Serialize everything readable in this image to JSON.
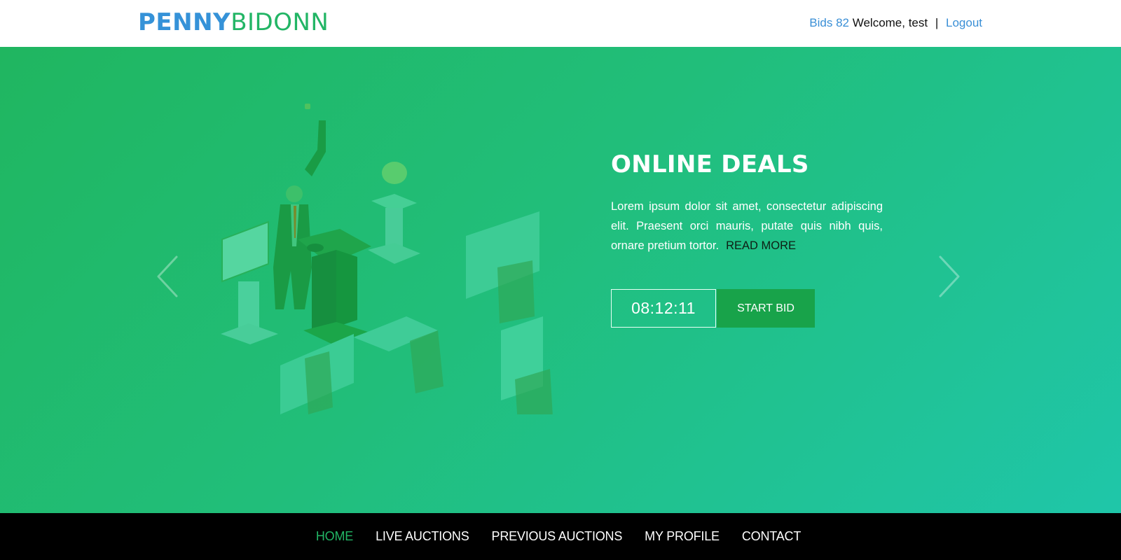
{
  "header": {
    "logo_part1": "PENNY",
    "logo_part2": "BIDONN",
    "bids_label": "Bids 82",
    "welcome_text": "Welcome, test",
    "separator": "|",
    "logout_label": "Logout"
  },
  "hero": {
    "title": "ONLINE DEALS",
    "description": "Lorem ipsum dolor sit amet, consectetur adipiscing elit. Praesent orci mauris, putate quis nibh quis, ornare pretium tortor.",
    "read_more_label": "READ MORE",
    "timer_value": "08:12:11",
    "start_bid_label": "START BID",
    "prev_icon": "chevron-left-icon",
    "next_icon": "chevron-right-icon",
    "illustration": "auction-room-illustration"
  },
  "nav": {
    "items": [
      {
        "label": "HOME",
        "active": true
      },
      {
        "label": "LIVE AUCTIONS",
        "active": false
      },
      {
        "label": "PREVIOUS AUCTIONS",
        "active": false
      },
      {
        "label": "MY PROFILE",
        "active": false
      },
      {
        "label": "CONTACT",
        "active": false
      }
    ]
  },
  "colors": {
    "brand_blue": "#3592d8",
    "brand_green": "#22b565",
    "start_bid_bg": "#18a34a",
    "hero_gradient_start": "#20b660",
    "hero_gradient_end": "#1fc6a9",
    "footer_bg": "#000000"
  }
}
